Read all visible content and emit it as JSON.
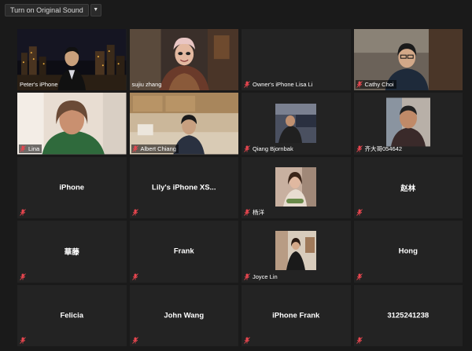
{
  "toolbar": {
    "original_sound_label": "Turn on Original Sound",
    "dropdown_icon": "chevron-down-icon"
  },
  "colors": {
    "active_speaker_border": "#b3d334",
    "mute_icon": "#e8464f",
    "tile_bg": "#232323"
  },
  "participants": [
    {
      "name": "Peter's iPhone",
      "kind": "video",
      "muted": false
    },
    {
      "name": "sujiu zhang",
      "kind": "video",
      "muted": false,
      "active_speaker": true
    },
    {
      "name": "Owner's iPhone Lisa Li",
      "kind": "blank",
      "muted": true
    },
    {
      "name": "Cathy Choi",
      "kind": "video",
      "muted": true
    },
    {
      "name": "Lina",
      "kind": "video",
      "muted": true
    },
    {
      "name": "Albert Chiang",
      "kind": "video",
      "muted": true
    },
    {
      "name": "Qiang Bjornbak",
      "kind": "photo",
      "muted": true
    },
    {
      "name": "齐大哥054642",
      "kind": "photo",
      "muted": true
    },
    {
      "name": "iPhone",
      "kind": "name",
      "muted": true
    },
    {
      "name": "Lily's iPhone XS...",
      "kind": "name",
      "muted": true
    },
    {
      "name": "杨洋",
      "kind": "photo",
      "muted": true
    },
    {
      "name": "赵林",
      "kind": "name",
      "muted": true
    },
    {
      "name": "華藤",
      "kind": "name",
      "muted": true
    },
    {
      "name": "Frank",
      "kind": "name",
      "muted": true
    },
    {
      "name": "Joyce Lin",
      "kind": "photo",
      "muted": true
    },
    {
      "name": "Hong",
      "kind": "name",
      "muted": true
    },
    {
      "name": "Felicia",
      "kind": "name",
      "muted": true
    },
    {
      "name": "John Wang",
      "kind": "name",
      "muted": true
    },
    {
      "name": "iPhone Frank",
      "kind": "name",
      "muted": true
    },
    {
      "name": "3125241238",
      "kind": "name",
      "muted": true
    }
  ]
}
